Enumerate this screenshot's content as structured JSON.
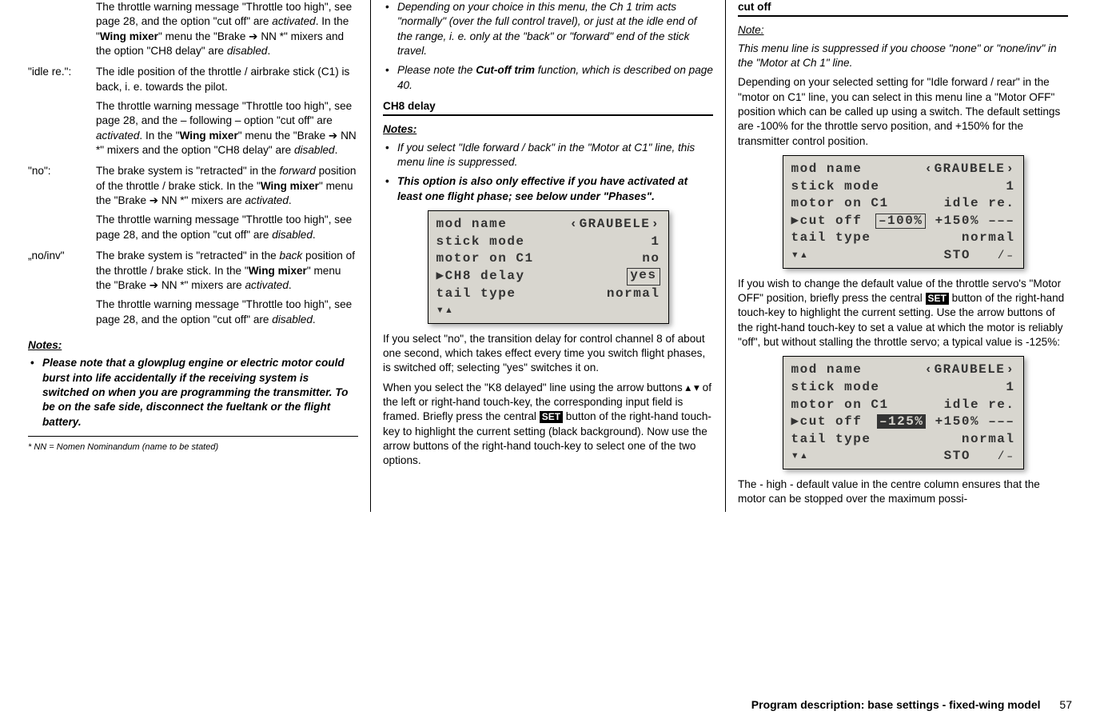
{
  "col1": {
    "p1": "The throttle warning message \"Throttle too high\", see page 28, and the option \"cut off\" are ",
    "p1b": "activated",
    "p1c": ". In the \"",
    "p1d": "Wing mixer",
    "p1e": "\" menu the \"Brake ",
    "p1f": " NN *\" mixers and the option \"CH8 delay\" are ",
    "p1g": "disabled",
    "p1h": ".",
    "idle_re": {
      "term": "\"idle re.\":",
      "b1": "The idle position of the throttle / airbrake stick (C1) is back, i. e. towards the pilot.",
      "b2a": "The throttle warning message \"Throttle too high\", see page 28, and the – following – op­tion \"cut off\" are ",
      "b2b": "activated",
      "b2c": ". In the \"",
      "b2d": "Wing mixer",
      "b2e": "\" menu the \"Brake ",
      "b2f": " NN *\" mixers and the option \"CH8 delay\" are ",
      "b2g": "disabled",
      "b2h": "."
    },
    "no": {
      "term": "\"no\":",
      "b1a": "The brake system is \"retracted\" in the ",
      "b1b": "for­ward",
      "b1c": " position of the throttle / brake stick. In the \"",
      "b1d": "Wing mixer",
      "b1e": "\" menu the \"Brake ",
      "b1f": " NN *\" mixers are ",
      "b1g": "activated",
      "b1h": ".",
      "b2a": "The throttle warning message \"Throttle too high\", see page 28, and the option \"cut off\" are ",
      "b2b": "disabled",
      "b2c": "."
    },
    "noinv": {
      "term": "„no/inv\"",
      "b1a": "The brake system is \"retracted\" in the ",
      "b1b": "back",
      "b1c": " position of the throttle / brake stick. In the \"",
      "b1d": "Wing mixer",
      "b1e": "\" menu the \"Brake ",
      "b1f": " NN *\" mixers are ",
      "b1g": "activated",
      "b1h": ".",
      "b2a": "The throttle warning message \"Throttle too high\", see page 28, and the option \"cut off\" are ",
      "b2b": "disabled",
      "b2c": "."
    },
    "notes_hdr": "Notes:",
    "note1": "Please note that a glowplug engine or electric motor could burst into life accidentally if the re­ceiving system is switched on when you are pro­gramming the transmitter. To be on the safe side, disconnect the fueltank or the flight battery.",
    "footnote": "*    NN = Nomen Nominandum (name to be stated)"
  },
  "col2": {
    "note2": "Depending on your choice in this menu, the Ch 1 trim acts \"normally\" (over the full control travel), or just at the idle end of the range, i. e. only at the \"back\" or \"forward\" end of the stick travel.",
    "note3a": "Please note the ",
    "note3b": "Cut-off trim",
    "note3c": " function, which is de­scribed on page 40.",
    "sec1": "CH8 delay",
    "notes_hdr": "Notes:",
    "n1": "If you select \"Idle forward / back\" in the \"Motor at C1\" line, this menu line is suppressed.",
    "n2": "This option is also only effective if you have acti­vated at least one flight phase; see below under \"Phases\".",
    "lcd1": {
      "r1a": "mod name",
      "r1b": "GRAUBELE",
      "r2a": "stick mode",
      "r2b": "1",
      "r3a": "motor on C1",
      "r3b": "no",
      "r4a": "CH8 delay",
      "r4b": "yes",
      "r5a": "tail type",
      "r5b": "normal"
    },
    "p1": "If you select \"no\", the transition delay for control channel 8 of about one second, which takes effect every time you switch flight phases, is switched off; selecting \"yes\" switches it on.",
    "p2a": "When you select the \"K8 delayed\" line using the arrow buttons ",
    "p2b": " of the left or right-hand touch-key, the cor­responding input field is framed. Briefly press the central ",
    "p2c": " button of the right-hand touch-key to highlight the current setting (black background). Now use the arrow buttons of the right-hand touch-key to select one of the two options.",
    "set": "SET"
  },
  "col3": {
    "sec1": "cut off",
    "note_hdr": "Note:",
    "note1": "This menu line is suppressed if you choose \"none\" or \"none/inv\" in the \"Motor at Ch 1\" line.",
    "p1": "Depending on your selected setting for \"Idle forward / rear\" in the \"motor on C1\" line, you can select in this menu line a \"Motor OFF\" position which can be called up using a switch. The default settings are -100% for the throttle servo position, and +150% for the transmitter control position.",
    "lcd1": {
      "r1a": "mod name",
      "r1b": "GRAUBELE",
      "r2a": "stick mode",
      "r2b": "1",
      "r3a": "motor on C1",
      "r3b": "idle re.",
      "r4a": "cut off",
      "r4b": "–100%",
      "r4c": "+150% –––",
      "r5a": "tail type",
      "r5b": "normal",
      "r6": "STO"
    },
    "p2a": "If you wish to change the default value of the throttle servo's \"Motor OFF\" position, briefly press the central ",
    "p2b": " button of the right-hand touch-key to highlight the current setting. Use the arrow buttons of the right-hand touch-key to set a value at which the motor is reliably \"off\", but without stalling the throttle servo; a typical value is -125%:",
    "set": "SET",
    "lcd2": {
      "r1a": "mod name",
      "r1b": "GRAUBELE",
      "r2a": "stick mode",
      "r2b": "1",
      "r3a": "motor on C1",
      "r3b": "idle re.",
      "r4a": "cut off",
      "r4b": "–125%",
      "r4c": "+150% –––",
      "r5a": "tail type",
      "r5b": "normal",
      "r6": "STO"
    },
    "p3": "The - high - default value in the centre column ensures that the motor can be stopped over the maximum possi-"
  },
  "footer": {
    "text": "Program description: base settings - fixed-wing model",
    "page": "57"
  }
}
